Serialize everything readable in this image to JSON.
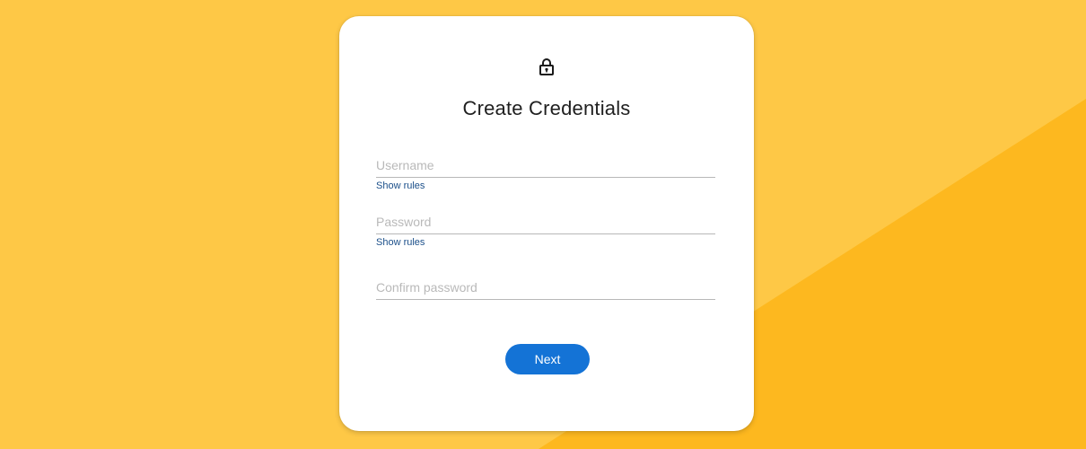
{
  "theme": {
    "background": "#fec846",
    "background_accent": "#fdb81f",
    "card": "#ffffff",
    "accent": "#1473d6",
    "link": "#1b4f8a"
  },
  "header": {
    "icon": "lock-icon",
    "title": "Create Credentials"
  },
  "form": {
    "username": {
      "placeholder": "Username",
      "value": "",
      "rules_link": "Show rules"
    },
    "password": {
      "placeholder": "Password",
      "value": "",
      "rules_link": "Show rules"
    },
    "confirm_password": {
      "placeholder": "Confirm password",
      "value": ""
    },
    "next_label": "Next"
  }
}
